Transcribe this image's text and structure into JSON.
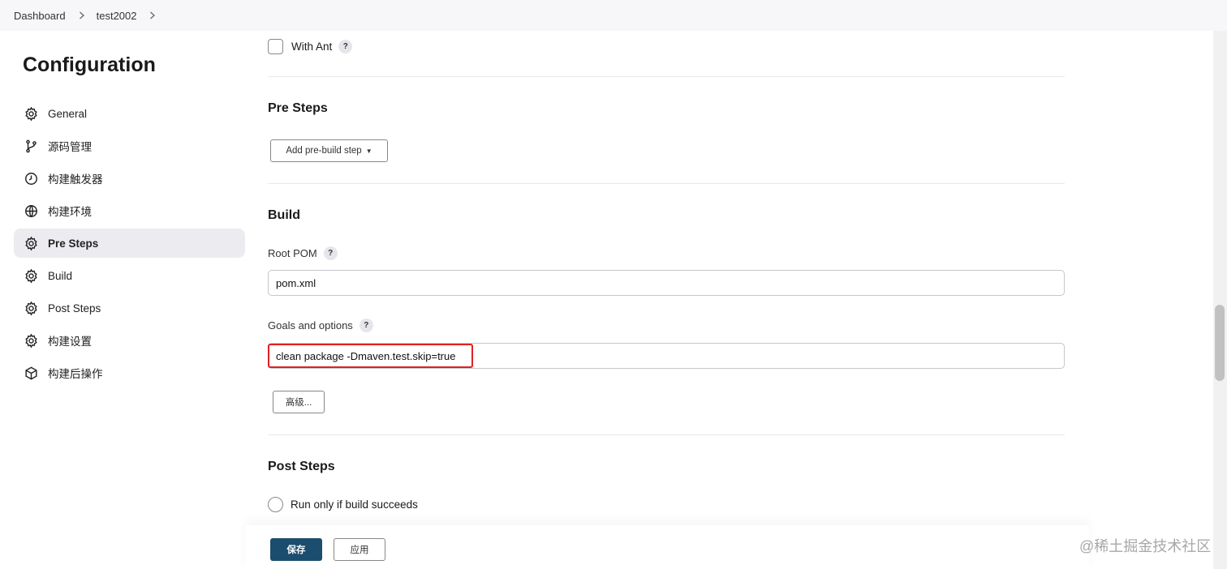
{
  "breadcrumb": {
    "items": [
      {
        "label": "Dashboard"
      },
      {
        "label": "test2002"
      }
    ]
  },
  "page": {
    "title": "Configuration"
  },
  "sidebar": {
    "items": [
      {
        "label": "General",
        "icon": "gear-icon"
      },
      {
        "label": "源码管理",
        "icon": "git-branch-icon"
      },
      {
        "label": "构建触发器",
        "icon": "clock-icon"
      },
      {
        "label": "构建环境",
        "icon": "globe-icon"
      },
      {
        "label": "Pre Steps",
        "icon": "gear-icon",
        "active": true
      },
      {
        "label": "Build",
        "icon": "gear-icon"
      },
      {
        "label": "Post Steps",
        "icon": "gear-icon"
      },
      {
        "label": "构建设置",
        "icon": "gear-icon"
      },
      {
        "label": "构建后操作",
        "icon": "cube-icon"
      }
    ]
  },
  "main": {
    "with_ant": {
      "label": "With Ant",
      "help": "?"
    },
    "pre_steps": {
      "title": "Pre Steps",
      "add_button": "Add pre-build step",
      "caret": "▼"
    },
    "build": {
      "title": "Build",
      "root_pom": {
        "label": "Root POM",
        "help": "?",
        "value": "pom.xml"
      },
      "goals": {
        "label": "Goals and options",
        "help": "?",
        "value": "clean package -Dmaven.test.skip=true"
      },
      "advanced_button": "高级..."
    },
    "post_steps": {
      "title": "Post Steps",
      "radio_label": "Run only if build succeeds"
    }
  },
  "footer": {
    "save_label": "保存",
    "apply_label": "应用"
  },
  "watermark": "@稀土掘金技术社区",
  "colors": {
    "primary": "#1b4d6e",
    "highlight": "#e02020",
    "active_bg": "#ececf0"
  }
}
